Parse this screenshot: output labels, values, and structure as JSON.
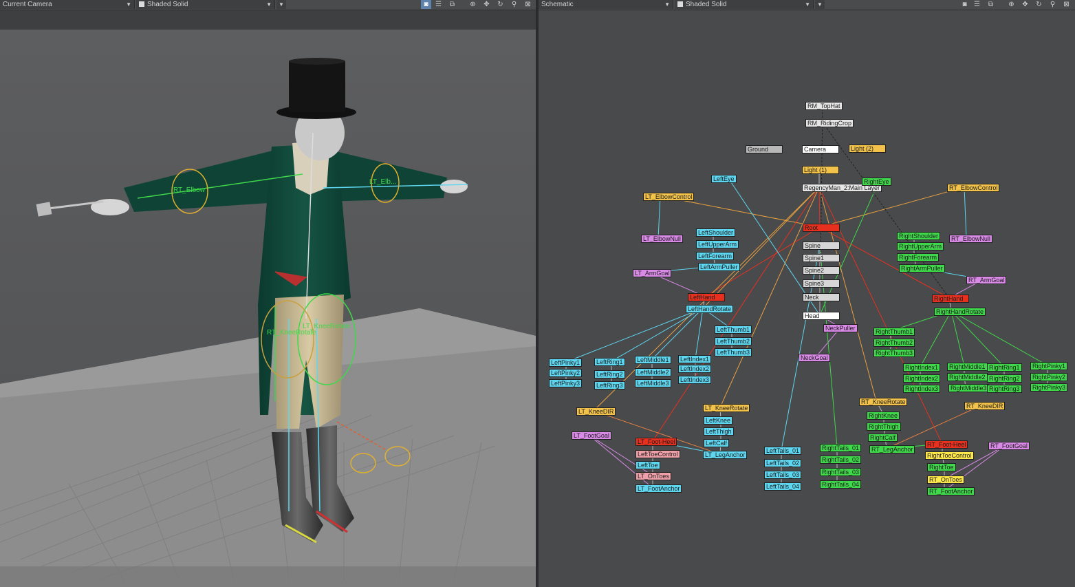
{
  "left_view": {
    "camera_dropdown": "Current Camera",
    "shading_dropdown": "Shaded Solid",
    "labels": {
      "rt_elbow": "RT_Elbow",
      "lt_elbow": "LT_Elb...",
      "lt_knee_rotate": "LT_KneeRotate",
      "rt_knee_rotate": "RT_KneeRotate"
    }
  },
  "right_view": {
    "view_dropdown": "Schematic",
    "shading_dropdown": "Shaded Solid",
    "nodes": [
      {
        "label": "RM_TopHat",
        "color": "#e6e6e6"
      },
      {
        "label": "RM_RidingCrop",
        "color": "#e6e6e6"
      },
      {
        "label": "Ground",
        "color": "#b8b8b8"
      },
      {
        "label": "Camera",
        "color": "#ffffff"
      },
      {
        "label": "Light (2)",
        "color": "#f2c24a"
      },
      {
        "label": "Light (1)",
        "color": "#f2c24a"
      },
      {
        "label": "RegencyMan_2:Main Layer",
        "color": "#e6e6e6"
      },
      {
        "label": "LeftEye",
        "color": "#5fd6f0"
      },
      {
        "label": "RightEye",
        "color": "#3fd84a"
      },
      {
        "label": "LT_ElbowControl",
        "color": "#f2c24a"
      },
      {
        "label": "RT_ElbowControl",
        "color": "#f2c24a"
      },
      {
        "label": "Root",
        "color": "#e8301f"
      },
      {
        "label": "LT_ElbowNull",
        "color": "#d98ae6"
      },
      {
        "label": "LeftShoulder",
        "color": "#5fd6f0"
      },
      {
        "label": "LeftUpperArm",
        "color": "#5fd6f0"
      },
      {
        "label": "LeftForearm",
        "color": "#5fd6f0"
      },
      {
        "label": "LeftArmPuller",
        "color": "#5fd6f0"
      },
      {
        "label": "Spine",
        "color": "#d6d6d6"
      },
      {
        "label": "Spine1",
        "color": "#d6d6d6"
      },
      {
        "label": "Spine2",
        "color": "#d6d6d6"
      },
      {
        "label": "Spine3",
        "color": "#d6d6d6"
      },
      {
        "label": "Neck",
        "color": "#d6d6d6"
      },
      {
        "label": "Head",
        "color": "#ffffff"
      },
      {
        "label": "RightShoulder",
        "color": "#3fd84a"
      },
      {
        "label": "RightUpperArm",
        "color": "#3fd84a"
      },
      {
        "label": "RightForearm",
        "color": "#3fd84a"
      },
      {
        "label": "RightArmPuller",
        "color": "#3fd84a"
      },
      {
        "label": "RT_ElbowNull",
        "color": "#d98ae6"
      },
      {
        "label": "LT_ArmGoal",
        "color": "#d98ae6"
      },
      {
        "label": "RT_ArmGoal",
        "color": "#d98ae6"
      },
      {
        "label": "LeftHand",
        "color": "#e8301f"
      },
      {
        "label": "RightHand",
        "color": "#e8301f"
      },
      {
        "label": "LeftHandRotate",
        "color": "#5fd6f0"
      },
      {
        "label": "RightHandRotate",
        "color": "#3fd84a"
      },
      {
        "label": "NeckPuller",
        "color": "#d98ae6"
      },
      {
        "label": "NeckGoal",
        "color": "#d98ae6"
      },
      {
        "label": "LeftThumb1",
        "color": "#5fd6f0"
      },
      {
        "label": "LeftThumb2",
        "color": "#5fd6f0"
      },
      {
        "label": "LeftThumb3",
        "color": "#5fd6f0"
      },
      {
        "label": "RightThumb1",
        "color": "#3fd84a"
      },
      {
        "label": "RightThumb2",
        "color": "#3fd84a"
      },
      {
        "label": "RightThumb3",
        "color": "#3fd84a"
      },
      {
        "label": "LeftPinky1",
        "color": "#5fd6f0"
      },
      {
        "label": "LeftPinky2",
        "color": "#5fd6f0"
      },
      {
        "label": "LeftPinky3",
        "color": "#5fd6f0"
      },
      {
        "label": "LeftRing1",
        "color": "#5fd6f0"
      },
      {
        "label": "LeftRing2",
        "color": "#5fd6f0"
      },
      {
        "label": "LeftRing3",
        "color": "#5fd6f0"
      },
      {
        "label": "LeftMiddle1",
        "color": "#5fd6f0"
      },
      {
        "label": "LeftMiddle2",
        "color": "#5fd6f0"
      },
      {
        "label": "LeftMiddle3",
        "color": "#5fd6f0"
      },
      {
        "label": "LeftIndex1",
        "color": "#5fd6f0"
      },
      {
        "label": "LeftIndex2",
        "color": "#5fd6f0"
      },
      {
        "label": "LeftIndex3",
        "color": "#5fd6f0"
      },
      {
        "label": "RightIndex1",
        "color": "#3fd84a"
      },
      {
        "label": "RightIndex2",
        "color": "#3fd84a"
      },
      {
        "label": "RightIndex3",
        "color": "#3fd84a"
      },
      {
        "label": "RightMiddle1",
        "color": "#3fd84a"
      },
      {
        "label": "RightMiddle2",
        "color": "#3fd84a"
      },
      {
        "label": "RightMiddle3",
        "color": "#3fd84a"
      },
      {
        "label": "RightRing1",
        "color": "#3fd84a"
      },
      {
        "label": "RightRing2",
        "color": "#3fd84a"
      },
      {
        "label": "RightRing3",
        "color": "#3fd84a"
      },
      {
        "label": "RightPinky1",
        "color": "#3fd84a"
      },
      {
        "label": "RightPinky2",
        "color": "#3fd84a"
      },
      {
        "label": "RightPinky3",
        "color": "#3fd84a"
      },
      {
        "label": "LT_KneeDIR",
        "color": "#f2c24a"
      },
      {
        "label": "LT_KneeRotate",
        "color": "#f2c24a"
      },
      {
        "label": "RT_KneeRotate",
        "color": "#f2c24a"
      },
      {
        "label": "RT_KneeDIR",
        "color": "#f2c24a"
      },
      {
        "label": "LeftKnee",
        "color": "#5fd6f0"
      },
      {
        "label": "LeftThigh",
        "color": "#5fd6f0"
      },
      {
        "label": "LeftCalf",
        "color": "#5fd6f0"
      },
      {
        "label": "LT_LegAnchor",
        "color": "#5fd6f0"
      },
      {
        "label": "RightKnee",
        "color": "#3fd84a"
      },
      {
        "label": "RightThigh",
        "color": "#3fd84a"
      },
      {
        "label": "RightCalf",
        "color": "#3fd84a"
      },
      {
        "label": "RT_LegAnchor",
        "color": "#3fd84a"
      },
      {
        "label": "LT_FootGoal",
        "color": "#d98ae6"
      },
      {
        "label": "RT_FootGoal",
        "color": "#d98ae6"
      },
      {
        "label": "LT_Foot-Heel",
        "color": "#e8301f"
      },
      {
        "label": "LeftToeControl",
        "color": "#f0a0a8"
      },
      {
        "label": "LeftToe",
        "color": "#5fd6f0"
      },
      {
        "label": "LT_OnToes",
        "color": "#f0a0a8"
      },
      {
        "label": "LT_FootAnchor",
        "color": "#5fd6f0"
      },
      {
        "label": "RT_Foot-Heel",
        "color": "#e8301f"
      },
      {
        "label": "RightToeControl",
        "color": "#ffe94a"
      },
      {
        "label": "RightToe",
        "color": "#3fd84a"
      },
      {
        "label": "RT_OnToes",
        "color": "#ffe94a"
      },
      {
        "label": "RT_FootAnchor",
        "color": "#3fd84a"
      },
      {
        "label": "LeftTails_01",
        "color": "#5fd6f0"
      },
      {
        "label": "LeftTails_02",
        "color": "#5fd6f0"
      },
      {
        "label": "LeftTails_03",
        "color": "#5fd6f0"
      },
      {
        "label": "LeftTails_04",
        "color": "#5fd6f0"
      },
      {
        "label": "RightTails_01",
        "color": "#3fd84a"
      },
      {
        "label": "RightTails_02",
        "color": "#3fd84a"
      },
      {
        "label": "RightTails_03",
        "color": "#3fd84a"
      },
      {
        "label": "RightTails_04",
        "color": "#3fd84a"
      }
    ]
  }
}
